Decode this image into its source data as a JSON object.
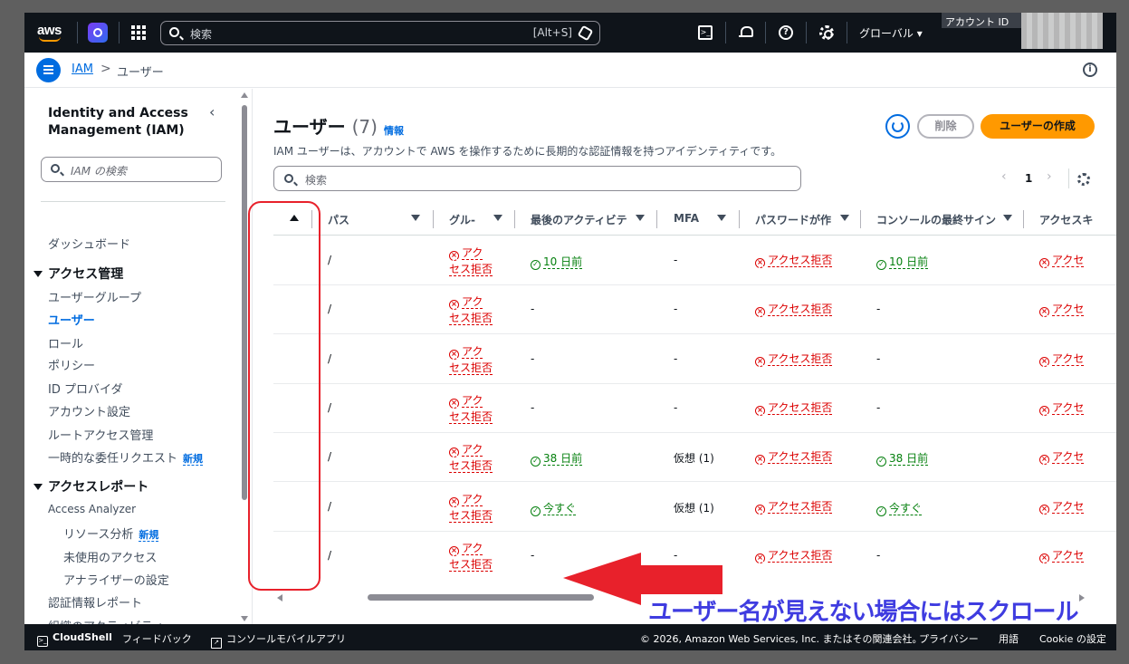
{
  "topnav": {
    "logo_text": "aws",
    "search_placeholder": "検索",
    "search_shortcut": "[Alt+S]",
    "region": "グローバル ▾",
    "account_label": "アカウント ID"
  },
  "breadcrumb": {
    "root": "IAM",
    "separator": ">",
    "current": "ユーザー"
  },
  "sidebar": {
    "title": "Identity and Access Management (IAM)",
    "collapse": "‹",
    "search_placeholder": "IAM の検索",
    "items": {
      "dashboard": "ダッシュボード",
      "access_mgmt": "アクセス管理",
      "user_groups": "ユーザーグループ",
      "users": "ユーザー",
      "roles": "ロール",
      "policies": "ポリシー",
      "id_providers": "ID プロバイダ",
      "account_settings": "アカウント設定",
      "root_access": "ルートアクセス管理",
      "temp_delegation": "一時的な委任リクエスト",
      "new_badge": "新規",
      "access_reports": "アクセスレポート",
      "access_analyzer": "Access Analyzer",
      "resource_analysis": "リソース分析",
      "unused_access": "未使用のアクセス",
      "analyzer_settings": "アナライザーの設定",
      "credential_report": "認証情報レポート",
      "org_activity": "組織のアクティビティ"
    }
  },
  "main": {
    "title": "ユーザー",
    "count": "(7)",
    "info": "情報",
    "description": "IAM ユーザーは、アカウントで AWS を操作するために長期的な認証情報を持つアイデンティティです。",
    "delete_button": "削除",
    "create_button": "ユーザーの作成",
    "search_placeholder": "検索",
    "page": "1",
    "prev": "‹",
    "next": "›"
  },
  "table": {
    "headers": {
      "path": "パス",
      "group": "グル-",
      "last_activity": "最後のアクティビテ",
      "mfa": "MFA",
      "password_age": "パスワードが作",
      "console_last": "コンソールの最終サイン",
      "access_key": "アクセスキ"
    },
    "denied_text": "アクセス拒否",
    "denied_line1": "アク",
    "denied_line2": "セス拒否",
    "denied_clip": "アクセ",
    "rows": [
      {
        "path": "/",
        "last_activity": "10 日前",
        "mfa": "-",
        "console_last": "10 日前"
      },
      {
        "path": "/",
        "last_activity": "-",
        "mfa": "-",
        "console_last": "-"
      },
      {
        "path": "/",
        "last_activity": "-",
        "mfa": "-",
        "console_last": "-"
      },
      {
        "path": "/",
        "last_activity": "-",
        "mfa": "-",
        "console_last": "-"
      },
      {
        "path": "/",
        "last_activity": "38 日前",
        "mfa": "仮想 (1)",
        "console_last": "38 日前"
      },
      {
        "path": "/",
        "last_activity": "今すぐ",
        "mfa": "仮想 (1)",
        "console_last": "今すぐ"
      },
      {
        "path": "/",
        "last_activity": "-",
        "mfa": "-",
        "console_last": "-"
      }
    ]
  },
  "footer": {
    "cloudshell": "CloudShell",
    "feedback": "フィードバック",
    "mobile_app": "コンソールモバイルアプリ",
    "copyright": "© 2026, Amazon Web Services, Inc. またはその関連会社。",
    "privacy": "プライバシー",
    "language": "用語",
    "cookie": "Cookie の設定"
  },
  "annotation": {
    "text": "ユーザー名が見えない場合にはスクロール",
    "colors": {
      "box": "#e8212b",
      "arrow": "#e8212b",
      "text": "#3f3ce0"
    }
  }
}
